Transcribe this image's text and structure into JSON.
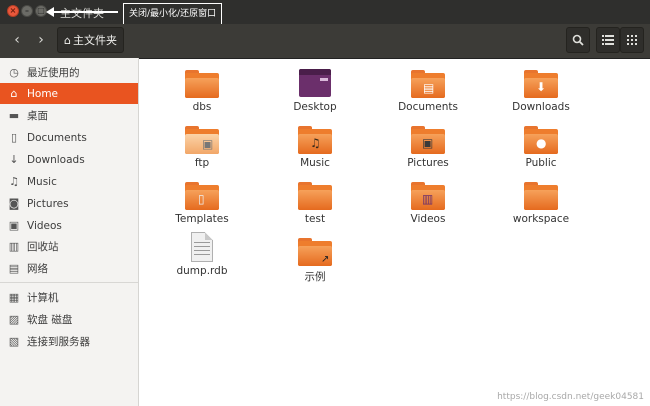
{
  "window": {
    "title": "主文件夹",
    "annotation": "关闭/最小化/还原窗口",
    "buttons": {
      "close": "×",
      "minimize": "–",
      "restore": "□"
    }
  },
  "toolbar": {
    "back_icon": "‹",
    "forward_icon": "›",
    "path_label": "主文件夹",
    "home_icon": "⌂",
    "search_icon": "search-icon",
    "list_view_icon": "list-icon",
    "grid_view_icon": "grid-icon"
  },
  "sidebar": {
    "items": [
      {
        "label": "最近使用的",
        "icon": "clock-icon"
      },
      {
        "label": "Home",
        "icon": "home-icon",
        "active": true
      },
      {
        "label": "桌面",
        "icon": "desktop-icon"
      },
      {
        "label": "Documents",
        "icon": "document-icon"
      },
      {
        "label": "Downloads",
        "icon": "download-icon"
      },
      {
        "label": "Music",
        "icon": "music-icon"
      },
      {
        "label": "Pictures",
        "icon": "camera-icon"
      },
      {
        "label": "Videos",
        "icon": "video-icon"
      },
      {
        "label": "回收站",
        "icon": "trash-icon"
      },
      {
        "label": "网络",
        "icon": "network-icon"
      },
      {
        "label": "计算机",
        "icon": "computer-icon"
      },
      {
        "label": "软盘 磁盘",
        "icon": "disk-icon"
      },
      {
        "label": "连接到服务器",
        "icon": "server-icon"
      }
    ],
    "accent_color": "#e95420"
  },
  "files": [
    {
      "name": "dbs",
      "type": "folder"
    },
    {
      "name": "Desktop",
      "type": "desktop"
    },
    {
      "name": "Documents",
      "type": "folder-documents"
    },
    {
      "name": "Downloads",
      "type": "folder-downloads"
    },
    {
      "name": "ftp",
      "type": "folder-shared"
    },
    {
      "name": "Music",
      "type": "folder-music"
    },
    {
      "name": "Pictures",
      "type": "folder-pictures"
    },
    {
      "name": "Public",
      "type": "folder-public"
    },
    {
      "name": "Templates",
      "type": "folder-templates"
    },
    {
      "name": "test",
      "type": "folder"
    },
    {
      "name": "Videos",
      "type": "folder-videos"
    },
    {
      "name": "workspace",
      "type": "folder"
    },
    {
      "name": "dump.rdb",
      "type": "file"
    },
    {
      "name": "示例",
      "type": "folder-link"
    }
  ],
  "watermark": "https://blog.csdn.net/geek04581"
}
